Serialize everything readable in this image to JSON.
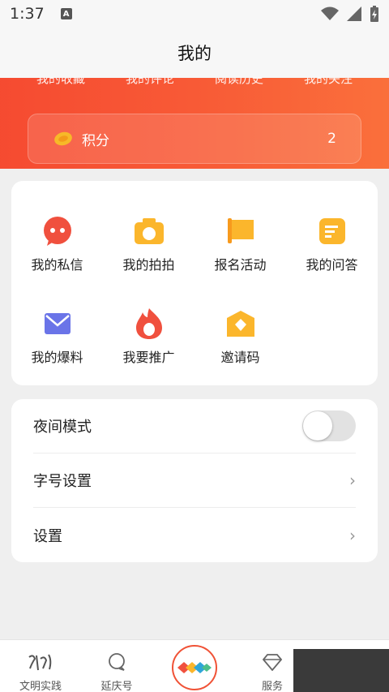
{
  "status_bar": {
    "time": "1:37",
    "indicator": "A"
  },
  "title": "我的",
  "header_tabs": [
    "我的收藏",
    "我的评论",
    "阅读历史",
    "我的关注"
  ],
  "points": {
    "label": "积分",
    "value": "2"
  },
  "grid": [
    {
      "label": "我的私信",
      "icon": "chat-bubble-icon"
    },
    {
      "label": "我的拍拍",
      "icon": "camera-icon"
    },
    {
      "label": "报名活动",
      "icon": "flag-icon"
    },
    {
      "label": "我的问答",
      "icon": "note-icon"
    },
    {
      "label": "我的爆料",
      "icon": "envelope-icon"
    },
    {
      "label": "我要推广",
      "icon": "flame-icon"
    },
    {
      "label": "邀请码",
      "icon": "diamond-icon"
    }
  ],
  "settings": {
    "night_mode": "夜间模式",
    "font_size": "字号设置",
    "settings": "设置",
    "night_mode_on": false
  },
  "nav": [
    {
      "label": "文明实践",
      "icon": "calligraphy-icon"
    },
    {
      "label": "延庆号",
      "icon": "chat-icon"
    },
    {
      "label": "",
      "icon": "center-logo-icon"
    },
    {
      "label": "服务",
      "icon": "gem-icon"
    }
  ],
  "colors": {
    "accent": "#f4432e",
    "accent_light": "#fb7a3e",
    "icon_yellow": "#fbb62c"
  }
}
